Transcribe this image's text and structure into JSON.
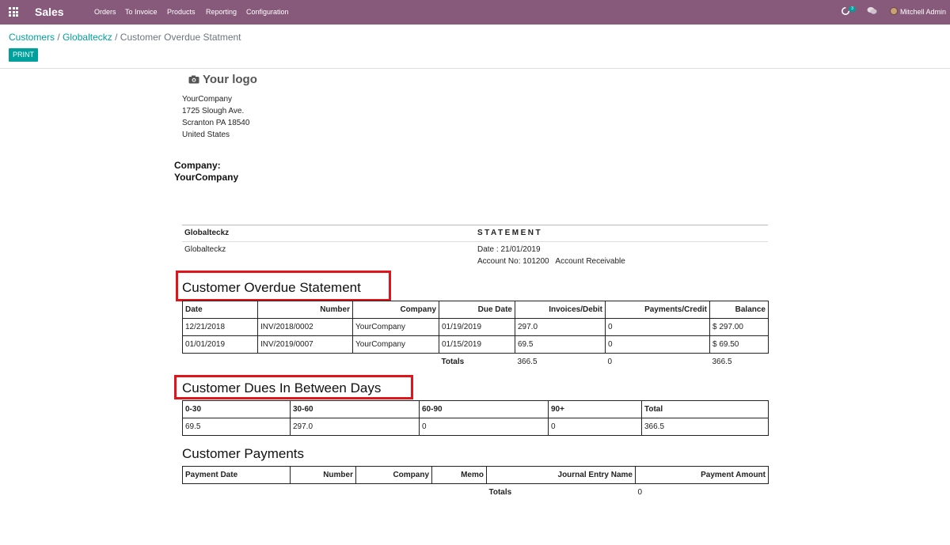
{
  "navbar": {
    "app_name": "Sales",
    "menu": [
      "Orders",
      "To Invoice",
      "Products",
      "Reporting",
      "Configuration"
    ],
    "activity_badge": "3",
    "user_name": "Mitchell Admin",
    "icons": [
      "apps-grid-icon",
      "activity-icon",
      "chat-icon",
      "avatar"
    ]
  },
  "breadcrumb": {
    "items": [
      "Customers",
      "Globalteckz"
    ],
    "separator": "/",
    "current": "Customer Overdue Statment"
  },
  "actions": {
    "print_label": "PRINT"
  },
  "report": {
    "logo_text": "Your logo",
    "company_address": [
      "YourCompany",
      "1725 Slough Ave.",
      "Scranton PA 18540",
      "United States"
    ],
    "company_label": "Company:",
    "company_name": "YourCompany",
    "partner_header": "Globalteckz",
    "statement_title": "STATEMENT",
    "partner_name": "Globalteckz",
    "date_line": "Date : 21/01/2019",
    "account_line": "Account No: 101200   Account Receivable",
    "overdue": {
      "title": "Customer Overdue Statement",
      "columns": [
        "Date",
        "Number",
        "Company",
        "Due Date",
        "Invoices/Debit",
        "Payments/Credit",
        "Balance"
      ],
      "rows": [
        [
          "12/21/2018",
          "INV/2018/0002",
          "YourCompany",
          "01/19/2019",
          "297.0",
          "0",
          "$ 297.00"
        ],
        [
          "01/01/2019",
          "INV/2019/0007",
          "YourCompany",
          "01/15/2019",
          "69.5",
          "0",
          "$ 69.50"
        ]
      ],
      "totals_label": "Totals",
      "totals": [
        "366.5",
        "0",
        "366.5"
      ]
    },
    "dues": {
      "title": "Customer Dues In Between Days",
      "columns": [
        "0-30",
        "30-60",
        "60-90",
        "90+",
        "Total"
      ],
      "row": [
        "69.5",
        "297.0",
        "0",
        "0",
        "366.5"
      ]
    },
    "payments": {
      "title": "Customer Payments",
      "columns": [
        "Payment Date",
        "Number",
        "Company",
        "Memo",
        "Journal Entry Name",
        "Payment Amount"
      ],
      "totals_label": "Totals",
      "total": "0"
    }
  },
  "colors": {
    "navbar": "#875a7b",
    "accent": "#00a09d",
    "highlight_box": "#e0141b"
  }
}
